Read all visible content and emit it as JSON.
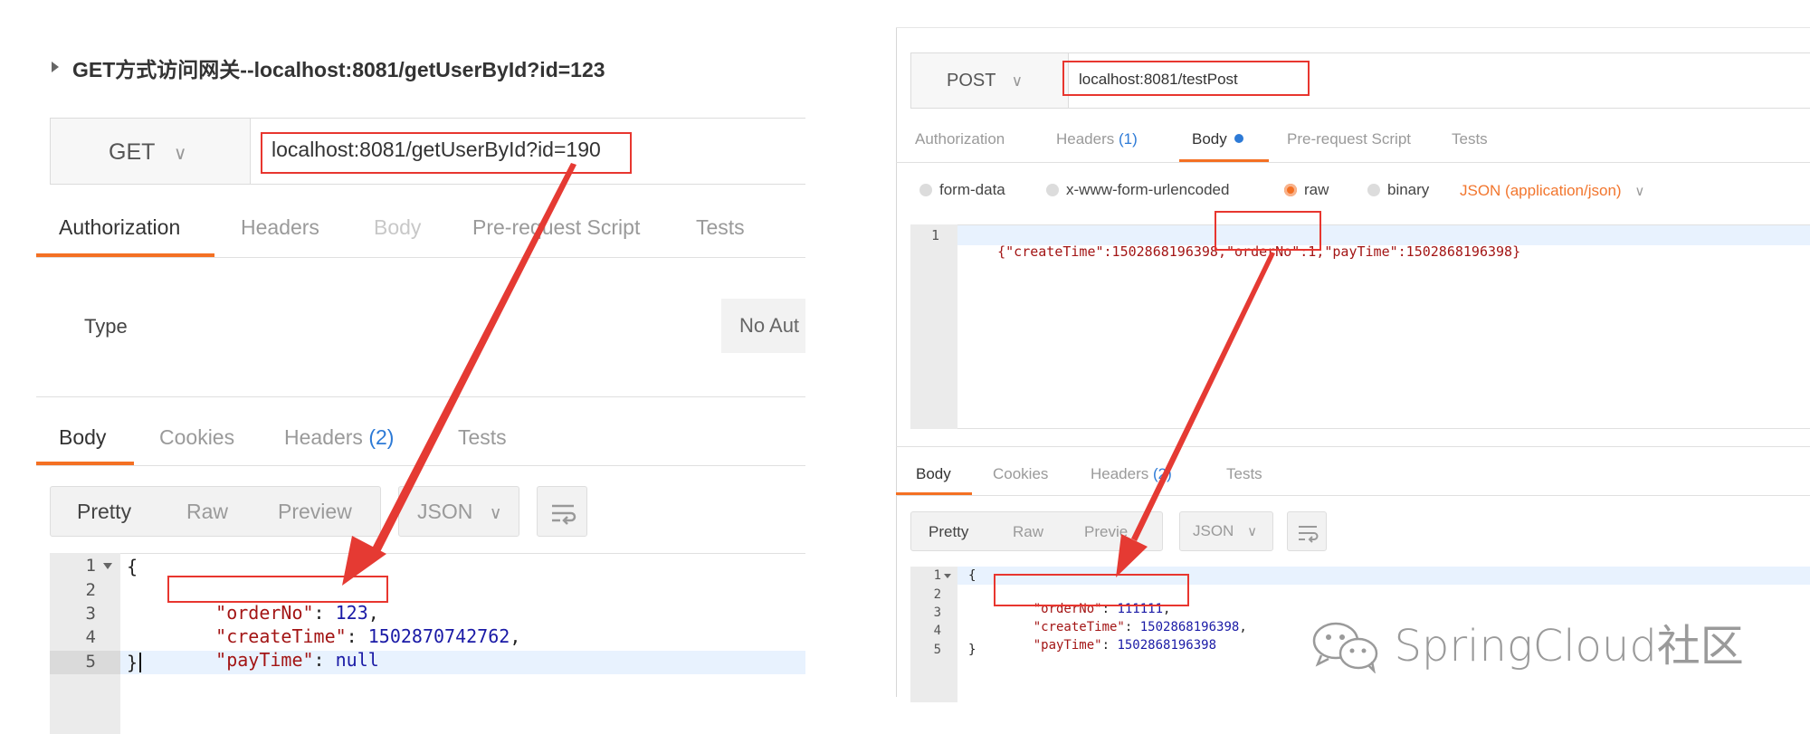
{
  "left": {
    "section_title": "GET方式访问网关--localhost:8081/getUserById?id=123",
    "method": "GET",
    "url": "localhost:8081/getUserById?id=190",
    "req_tabs": [
      "Authorization",
      "Headers",
      "Body",
      "Pre-request Script",
      "Tests"
    ],
    "type_label": "Type",
    "auth_value": "No Aut",
    "resp_tabs": {
      "body": "Body",
      "cookies": "Cookies",
      "headers": "Headers",
      "headers_count": "(2)",
      "tests": "Tests"
    },
    "view_modes": [
      "Pretty",
      "Raw",
      "Preview"
    ],
    "format": "JSON",
    "line_numbers": [
      "1",
      "2",
      "3",
      "4",
      "5"
    ],
    "json_lines": {
      "open": "{",
      "l2_key": "\"orderNo\"",
      "l2_val": "123",
      "l3_key": "\"createTime\"",
      "l3_val": "1502870742762",
      "l4_key": "\"payTime\"",
      "l4_val": "null",
      "close": "}"
    }
  },
  "right": {
    "method": "POST",
    "url": "localhost:8081/testPost",
    "req_tabs": {
      "authorization": "Authorization",
      "headers": "Headers",
      "headers_count": "(1)",
      "body": "Body",
      "pre_request": "Pre-request Script",
      "tests": "Tests"
    },
    "body_types": [
      "form-data",
      "x-www-form-urlencoded",
      "raw",
      "binary"
    ],
    "content_type": "JSON (application/json)",
    "request_line_number": "1",
    "request_body": {
      "p1": "{\"createTime\":1502868196398",
      "p2": ",\"orderNo\":1,",
      "p3": "\"payTime\":1502868196398}"
    },
    "resp_tabs": {
      "body": "Body",
      "cookies": "Cookies",
      "headers": "Headers",
      "headers_count": "(2)",
      "tests": "Tests"
    },
    "view_modes": [
      "Pretty",
      "Raw",
      "Previe"
    ],
    "format": "JSON",
    "line_numbers": [
      "1",
      "2",
      "3",
      "4",
      "5"
    ],
    "json_lines": {
      "open": "{",
      "l2_key": "\"orderNo\"",
      "l2_val": "111111",
      "l3_key": "\"createTime\"",
      "l3_val": "1502868196398",
      "l4_key": "\"payTime\"",
      "l4_val": "1502868196398",
      "close": "}"
    }
  },
  "watermark": "SpringCloud社区",
  "colors": {
    "accent": "#f47023",
    "highlight_box": "#e8362f",
    "arrow": "#e53a33",
    "link_blue": "#2d7ad6"
  }
}
